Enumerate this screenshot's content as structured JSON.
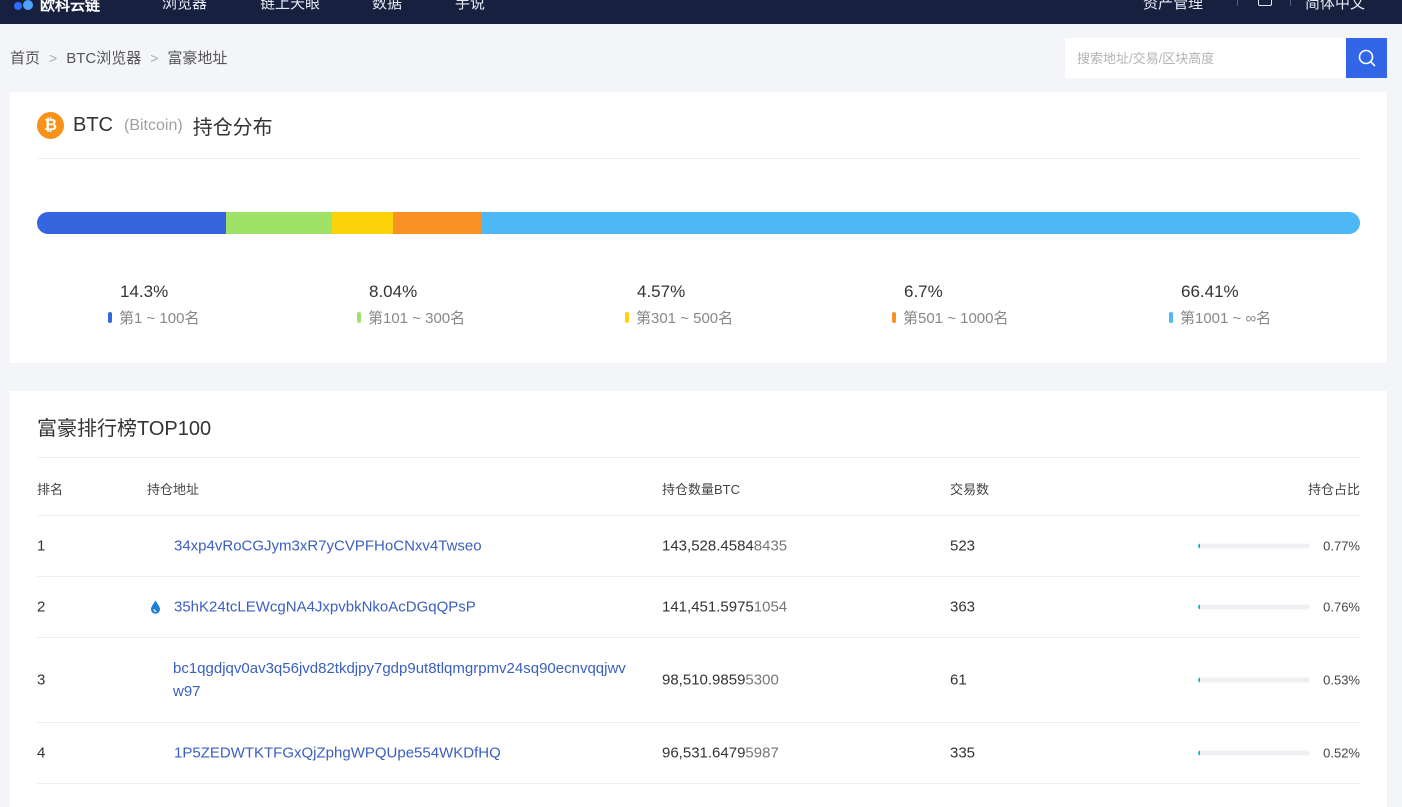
{
  "nav": {
    "logo": "欧科云链",
    "items": [
      "浏览器",
      "链上天眼",
      "数据",
      "手说"
    ],
    "right_items": [
      "资产管理",
      "简体中文"
    ]
  },
  "breadcrumb": [
    "首页",
    "BTC浏览器",
    "富豪地址"
  ],
  "search": {
    "placeholder": "搜索地址/交易/区块高度"
  },
  "distribution": {
    "symbol": "BTC",
    "name": "(Bitcoin)",
    "title": "持仓分布",
    "segments": [
      {
        "pct": "14.3%",
        "label": "第1 ~ 100名",
        "color": "#3566e0",
        "share": 14.3
      },
      {
        "pct": "8.04%",
        "label": "第101 ~ 300名",
        "color": "#9ee267",
        "share": 8.04
      },
      {
        "pct": "4.57%",
        "label": "第301 ~ 500名",
        "color": "#fcd20b",
        "share": 4.57
      },
      {
        "pct": "6.7%",
        "label": "第501 ~ 1000名",
        "color": "#fa9127",
        "share": 6.7
      },
      {
        "pct": "66.41%",
        "label": "第1001 ~ ∞名",
        "color": "#4db8f5",
        "share": 66.41
      }
    ]
  },
  "ranking": {
    "title": "富豪排行榜TOP100",
    "headers": {
      "rank": "排名",
      "address": "持仓地址",
      "amount": "持仓数量BTC",
      "tx": "交易数",
      "ratio": "持仓占比"
    },
    "rows": [
      {
        "rank": "1",
        "address": "34xp4vRoCGJym3xR7yCVPFHoCNxv4Twseo",
        "amount_main": "143,528.4584",
        "amount_frac": "8435",
        "tx": "523",
        "ratio": "0.77%",
        "ratio_value": 0.77,
        "icon": ""
      },
      {
        "rank": "2",
        "address": "35hK24tcLEWcgNA4JxpvbkNkoAcDGqQPsP",
        "amount_main": "141,451.5975",
        "amount_frac": "1054",
        "tx": "363",
        "ratio": "0.76%",
        "ratio_value": 0.76,
        "icon": "water-drop-icon"
      },
      {
        "rank": "3",
        "address": "bc1qgdjqv0av3q56jvd82tkdjpy7gdp9ut8tlqmgrpmv24sq90ecnvqqjwvw97",
        "amount_main": "98,510.9859",
        "amount_frac": "5300",
        "tx": "61",
        "ratio": "0.53%",
        "ratio_value": 0.53,
        "icon": ""
      },
      {
        "rank": "4",
        "address": "1P5ZEDWTKTFGxQjZphgWPQUpe554WKDfHQ",
        "amount_main": "96,531.6479",
        "amount_frac": "5987",
        "tx": "335",
        "ratio": "0.52%",
        "ratio_value": 0.52,
        "icon": ""
      }
    ]
  }
}
